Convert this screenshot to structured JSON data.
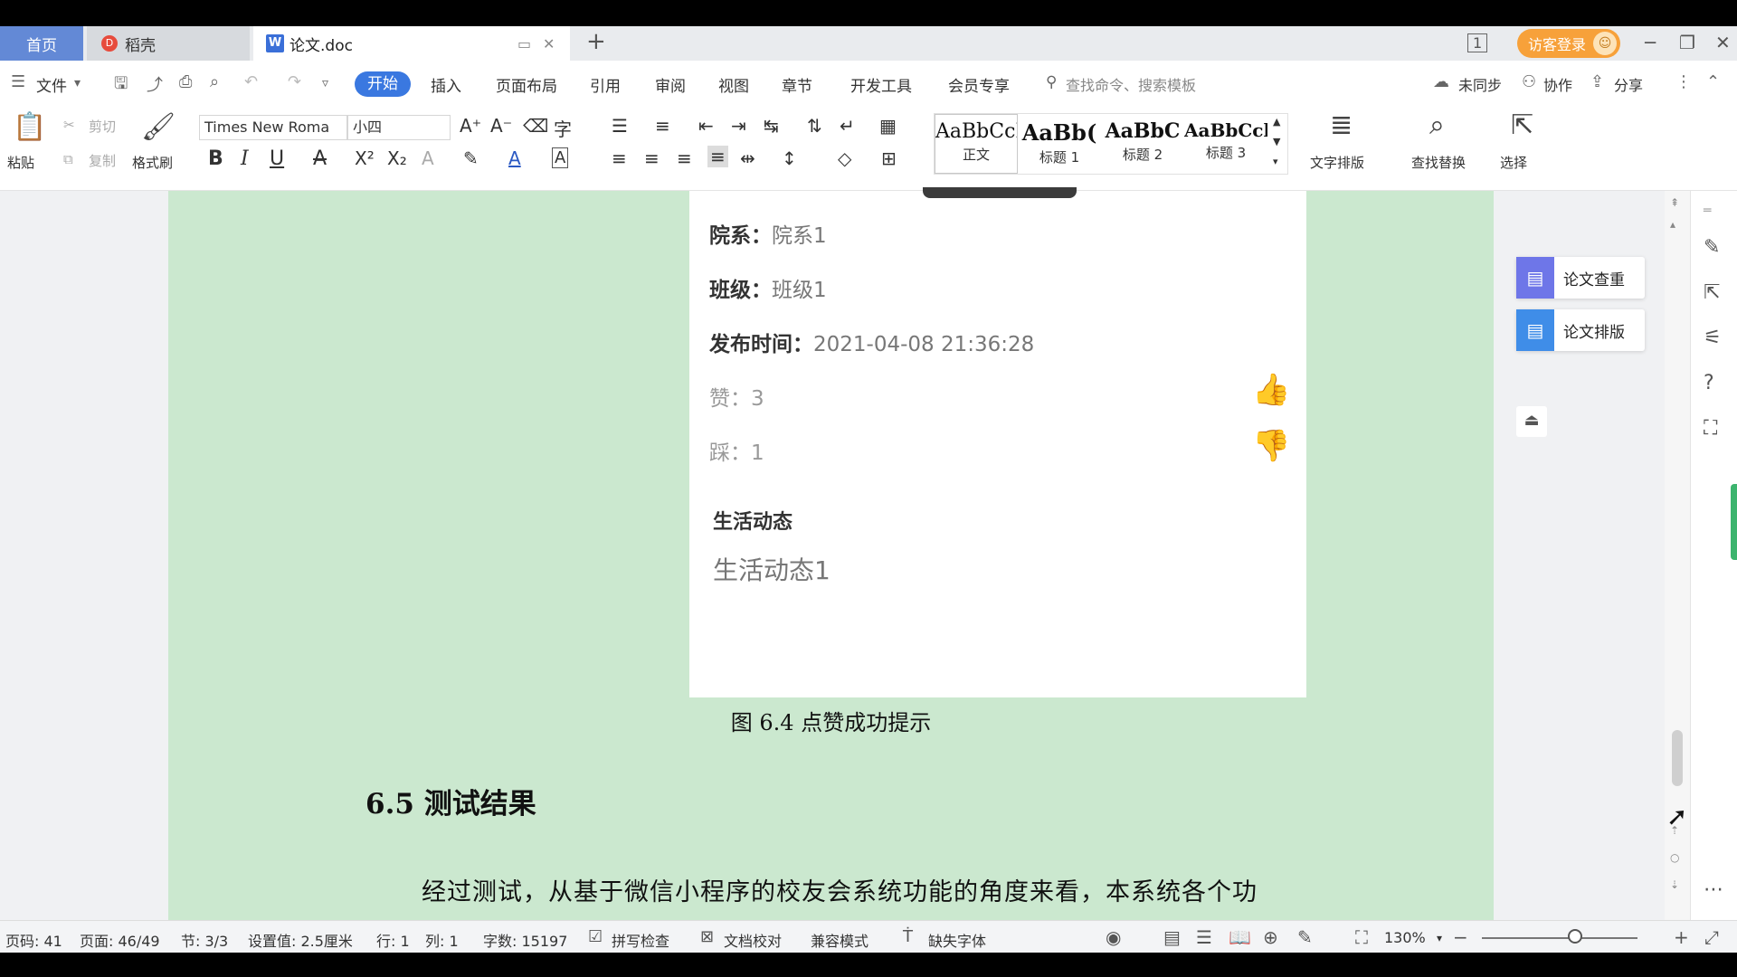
{
  "tabs": {
    "home": "首页",
    "daoke": "稻壳",
    "doc": "论文.doc",
    "new_tab": "+"
  },
  "window": {
    "page_indicator": "1",
    "visitor_login": "访客登录",
    "minimize": "─",
    "restore": "❐",
    "close": "✕"
  },
  "menu": {
    "file": "文件",
    "items": [
      "开始",
      "插入",
      "页面布局",
      "引用",
      "审阅",
      "视图",
      "章节",
      "开发工具",
      "会员专享"
    ],
    "search_placeholder": "查找命令、搜索模板",
    "unsync": "未同步",
    "collaborate": "协作",
    "share": "分享"
  },
  "ribbon": {
    "paste": "粘贴",
    "cut": "剪切",
    "copy": "复制",
    "format_painter": "格式刷",
    "font_name": "Times New Roma",
    "font_size": "小四",
    "styles": [
      {
        "sample": "AaBbCcI",
        "label": "正文"
      },
      {
        "sample": "AaBb(",
        "label": "标题 1"
      },
      {
        "sample": "AaBbC",
        "label": "标题 2"
      },
      {
        "sample": "AaBbCcl",
        "label": "标题 3"
      }
    ],
    "text_layout": "文字排版",
    "find_replace": "查找替换",
    "select": "选择"
  },
  "document": {
    "fields": [
      {
        "key": "院系：",
        "value": "院系1"
      },
      {
        "key": "班级：",
        "value": "班级1"
      },
      {
        "key": "发布时间：",
        "value": "2021-04-08 21:36:28"
      }
    ],
    "likes": "赞：3",
    "dislikes": "踩：1",
    "section_title": "生活动态",
    "section_body": "生活动态1",
    "caption": "图 6.4  点赞成功提示",
    "heading": "6.5  测试结果",
    "paragraph": "经过测试，从基于微信小程序的校友会系统功能的角度来看，本系统各个功"
  },
  "side_panel": {
    "paper_check": "论文查重",
    "paper_format": "论文排版"
  },
  "status": {
    "page_code": "页码: 41",
    "page": "页面: 46/49",
    "section": "节: 3/3",
    "setting": "设置值: 2.5厘米",
    "row": "行: 1",
    "col": "列: 1",
    "word_count": "字数: 15197",
    "spell_check": "拼写检查",
    "doc_proof": "文档校对",
    "compat_mode": "兼容模式",
    "missing_font": "缺失字体",
    "zoom": "130%"
  }
}
